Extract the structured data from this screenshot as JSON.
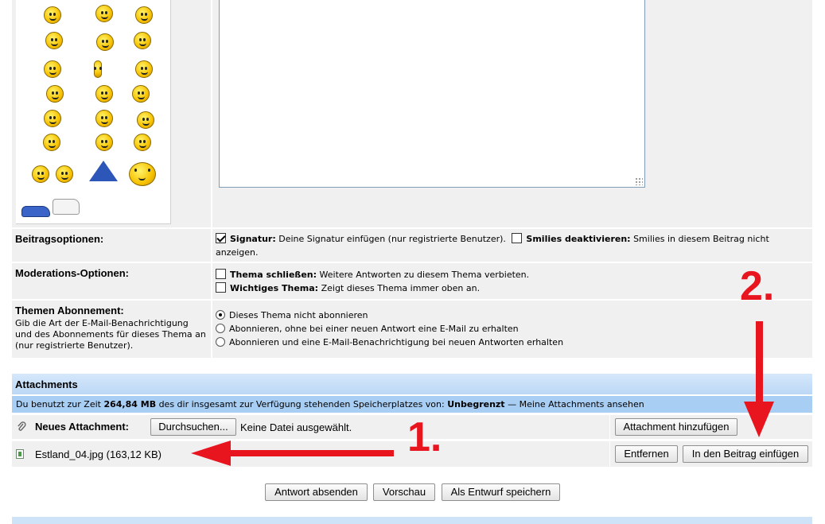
{
  "options": {
    "post_options": {
      "label": "Beitragsoptionen:",
      "signature_title": "Signatur:",
      "signature_text": "Deine Signatur einfügen (nur registrierte Benutzer).",
      "signature_checked": true,
      "smilies_title": "Smilies deaktivieren:",
      "smilies_text": "Smilies in diesem Beitrag nicht",
      "smilies_text_cont": "anzeigen."
    },
    "moderation": {
      "label": "Moderations-Optionen:",
      "close_title": "Thema schließen:",
      "close_text": "Weitere Antworten zu diesem Thema verbieten.",
      "important_title": "Wichtiges Thema:",
      "important_text": "Zeigt dieses Thema immer oben an."
    },
    "subscription": {
      "label": "Themen Abonnement:",
      "desc": "Gib die Art der E-Mail-Benachrichtigung und des Abonnements für dieses Thema an (nur registrierte Benutzer).",
      "choices": [
        "Dieses Thema nicht abonnieren",
        "Abonnieren, ohne bei einer neuen Antwort eine E-Mail zu erhalten",
        "Abonnieren und eine E-Mail-Benachrichtigung bei neuen Antworten erhalten"
      ],
      "selected_index": 0
    }
  },
  "attachments": {
    "header": "Attachments",
    "info_prefix": "Du benutzt zur Zeit",
    "used": "264,84 MB",
    "info_middle": "des dir insgesamt zur Verfügung stehenden Speicherplatzes von:",
    "total": "Unbegrenzt",
    "info_suffix": "— Meine Attachments ansehen",
    "new_label": "Neues Attachment:",
    "browse_button": "Durchsuchen...",
    "no_file": "Keine Datei ausgewählt.",
    "add_button": "Attachment hinzufügen",
    "file_name": "Estland_04.jpg (163,12 KB)",
    "remove_button": "Entfernen",
    "insert_button": "In den Beitrag einfügen"
  },
  "actions": {
    "submit": "Antwort absenden",
    "preview": "Vorschau",
    "save_draft": "Als Entwurf speichern"
  },
  "annotations": {
    "step1": "1.",
    "step2": "2.",
    "color": "#e8141e"
  }
}
